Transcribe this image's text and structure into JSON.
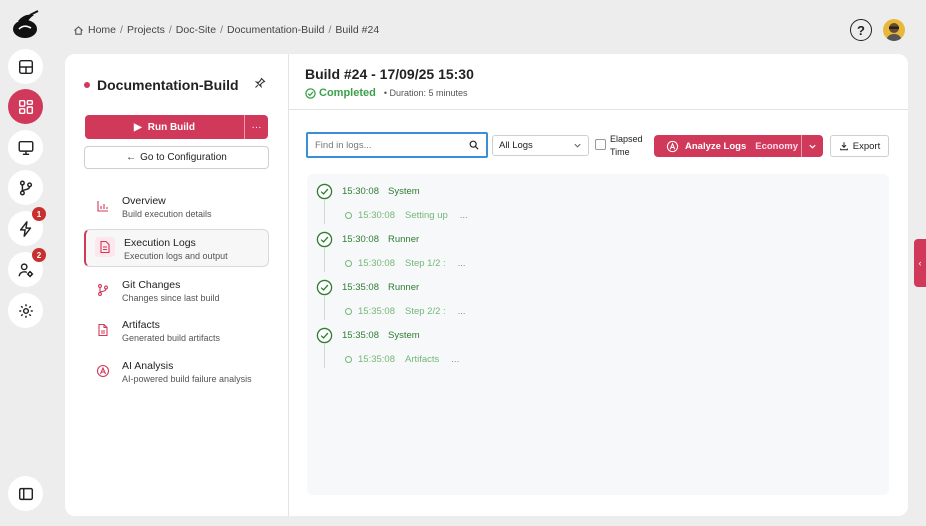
{
  "breadcrumb": [
    "Home",
    "Projects",
    "Doc-Site",
    "Documentation-Build",
    "Build #24"
  ],
  "rail": {
    "badges": {
      "lightning": "1",
      "users": "2"
    }
  },
  "sidebar": {
    "project_title": "Documentation-Build",
    "run_label": "Run Build",
    "more_label": "···",
    "config_label": "Go to Configuration",
    "nav": [
      {
        "title": "Overview",
        "subtitle": "Build execution details"
      },
      {
        "title": "Execution Logs",
        "subtitle": "Execution logs and output"
      },
      {
        "title": "Git Changes",
        "subtitle": "Changes since last build"
      },
      {
        "title": "Artifacts",
        "subtitle": "Generated build artifacts"
      },
      {
        "title": "AI Analysis",
        "subtitle": "AI-powered build failure analysis"
      }
    ]
  },
  "build": {
    "title": "Build #24 - 17/09/25 15:30",
    "status": "Completed",
    "duration": "Duration: 5 minutes"
  },
  "toolbar": {
    "search_placeholder": "Find in logs...",
    "filter_value": "All Logs",
    "elapsed_line1": "Elapsed",
    "elapsed_line2": "Time",
    "analyze_label": "Analyze Logs",
    "analyze_tier": "Economy",
    "export_label": "Export"
  },
  "logs": [
    {
      "time": "15:30:08",
      "source": "System",
      "sub_time": "15:30:08",
      "sub_msg": "Setting up",
      "sub_ellipsis": "..."
    },
    {
      "time": "15:30:08",
      "source": "Runner",
      "sub_time": "15:30:08",
      "sub_msg": "Step 1/2 :",
      "sub_ellipsis": "..."
    },
    {
      "time": "15:35:08",
      "source": "Runner",
      "sub_time": "15:35:08",
      "sub_msg": "Step 2/2 :",
      "sub_ellipsis": "..."
    },
    {
      "time": "15:35:08",
      "source": "System",
      "sub_time": "15:35:08",
      "sub_msg": "Artifacts",
      "sub_ellipsis": "..."
    }
  ],
  "colors": {
    "accent": "#d1395a",
    "success": "#3aa04a",
    "focus": "#3a8fd8"
  }
}
